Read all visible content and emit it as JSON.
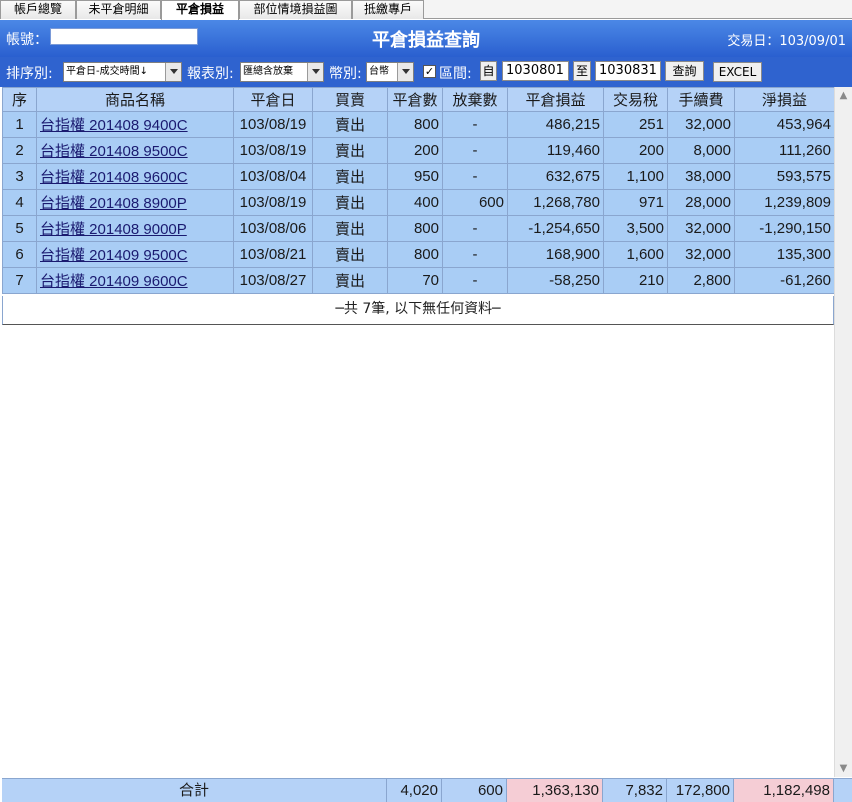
{
  "tabs": [
    {
      "label": "帳戶總覽"
    },
    {
      "label": "未平倉明細"
    },
    {
      "label": "平倉損益"
    },
    {
      "label": "部位情境損益圖"
    },
    {
      "label": "抵繳專戶"
    }
  ],
  "header": {
    "account_label": "帳號：",
    "account_value": "",
    "title": "平倉損益查詢",
    "trade_date": "交易日：103/09/01"
  },
  "filters": {
    "sort_label": "排序別:",
    "sort_value": "平倉日-成交時間↓",
    "report_label": "報表別:",
    "report_value": "匯總含放棄",
    "currency_label": "幣別:",
    "currency_value": "台幣",
    "range_label": "區間:",
    "range_checked": "✓",
    "from_label": "自",
    "from_value": "1030801",
    "to_label": "至",
    "to_value": "1030831",
    "query_button": "查詢",
    "excel_button": "EXCEL"
  },
  "table": {
    "headers": [
      "序",
      "商品名稱",
      "平倉日",
      "買賣",
      "平倉數",
      "放棄數",
      "平倉損益",
      "交易稅",
      "手續費",
      "淨損益"
    ],
    "rows": [
      [
        "1",
        "台指權 201408 9400C",
        "103/08/19",
        "賣出",
        "800",
        "-",
        "486,215",
        "251",
        "32,000",
        "453,964"
      ],
      [
        "2",
        "台指權 201408 9500C",
        "103/08/19",
        "賣出",
        "200",
        "-",
        "119,460",
        "200",
        "8,000",
        "111,260"
      ],
      [
        "3",
        "台指權 201408 9600C",
        "103/08/04",
        "賣出",
        "950",
        "-",
        "632,675",
        "1,100",
        "38,000",
        "593,575"
      ],
      [
        "4",
        "台指權 201408 8900P",
        "103/08/19",
        "賣出",
        "400",
        "600",
        "1,268,780",
        "971",
        "28,000",
        "1,239,809"
      ],
      [
        "5",
        "台指權 201408 9000P",
        "103/08/06",
        "賣出",
        "800",
        "-",
        "-1,254,650",
        "3,500",
        "32,000",
        "-1,290,150"
      ],
      [
        "6",
        "台指權 201409 9500C",
        "103/08/21",
        "賣出",
        "800",
        "-",
        "168,900",
        "1,600",
        "32,000",
        "135,300"
      ],
      [
        "7",
        "台指權 201409 9600C",
        "103/08/27",
        "賣出",
        "70",
        "-",
        "-58,250",
        "210",
        "2,800",
        "-61,260"
      ]
    ],
    "footnote": "─共 7筆, 以下無任何資料─"
  },
  "totals": {
    "label": "合計",
    "close_qty": "4,020",
    "abandon_qty": "600",
    "close_pl": "1,363,130",
    "tax": "7,832",
    "fee": "172,800",
    "net_pl": "1,182,498"
  },
  "colors": {
    "header_blue": "#2f63cf",
    "row_blue": "#a9cdf5",
    "total_pink": "#f5cdd5"
  }
}
